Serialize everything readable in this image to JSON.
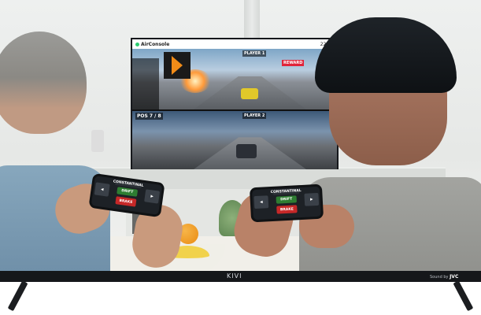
{
  "tv": {
    "app_name": "AirConsole",
    "clock": "22:11",
    "brand": "KIVI",
    "sound_prefix": "Sound by",
    "sound_brand": "JVC"
  },
  "game": {
    "top_player": "PLAYER 1",
    "top_score": "REWARD",
    "bottom_pos": "POS 7 / 8",
    "bottom_player": "PLAYER 2"
  },
  "controller": {
    "title": "CONSTANTINAL",
    "drift": "DRIFT",
    "brake": "BRAKE"
  },
  "colors": {
    "accent_orange": "#f28c18",
    "drift_green": "#2e7d32",
    "brake_red": "#c62828"
  }
}
